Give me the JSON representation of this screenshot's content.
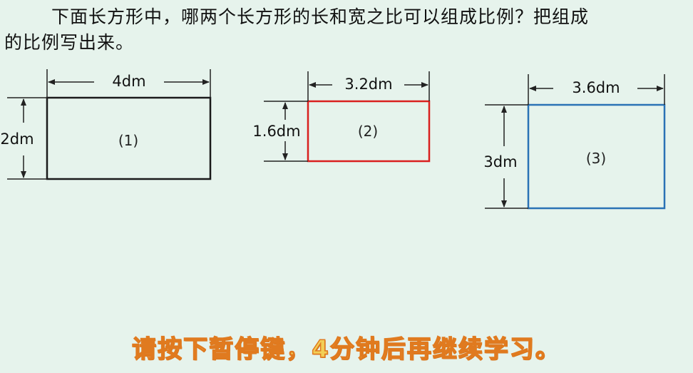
{
  "question": {
    "line1": "下面长方形中，哪两个长方形的长和宽之比可以组成比例？把组成",
    "line2": "的比例写出来。"
  },
  "rectangles": [
    {
      "label": "(1)",
      "length": "4dm",
      "width": "2dm",
      "color": "#1a1a1a"
    },
    {
      "label": "(2)",
      "length": "3.2dm",
      "width": "1.6dm",
      "color": "#d9201f"
    },
    {
      "label": "(3)",
      "length": "3.6dm",
      "width": "3dm",
      "color": "#2a72b5"
    }
  ],
  "notice": "请按下暂停键，4分钟后再继续学习。",
  "colors": {
    "background": "#e6f3ec",
    "notice_fill": "#f2cf57",
    "notice_stroke": "#e07a1f"
  }
}
